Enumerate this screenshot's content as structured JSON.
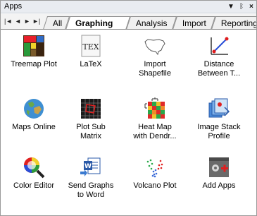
{
  "panel": {
    "title": "Apps",
    "menu_glyph": "▼",
    "pin_glyph": "ᛒ",
    "close_glyph": "×"
  },
  "nav": {
    "first": "|◄",
    "prev": "◄",
    "next": "►",
    "last": "►|"
  },
  "tabs": [
    {
      "label": "All"
    },
    {
      "label": "Graphing",
      "active": true
    },
    {
      "label": "Analysis"
    },
    {
      "label": "Import"
    },
    {
      "label": "Reporting"
    }
  ],
  "apps": [
    {
      "label": "Treemap Plot",
      "icon": "treemap-icon"
    },
    {
      "label": "LaTeX",
      "icon": "latex-icon"
    },
    {
      "label": "Import\nShapefile",
      "icon": "map-outline-icon"
    },
    {
      "label": "Distance\nBetween T...",
      "icon": "distance-line-icon"
    },
    {
      "label": "Maps Online",
      "icon": "globe-icon"
    },
    {
      "label": "Plot Sub\nMatrix",
      "icon": "mesh-icon"
    },
    {
      "label": "Heat Map\nwith Dendr...",
      "icon": "heatmap-icon"
    },
    {
      "label": "Image Stack\nProfile",
      "icon": "image-stack-icon"
    },
    {
      "label": "Color Editor",
      "icon": "color-magnifier-icon"
    },
    {
      "label": "Send Graphs\nto Word",
      "icon": "word-export-icon"
    },
    {
      "label": "Volcano Plot",
      "icon": "volcano-plot-icon"
    },
    {
      "label": "Add Apps",
      "icon": "add-apps-icon"
    }
  ]
}
